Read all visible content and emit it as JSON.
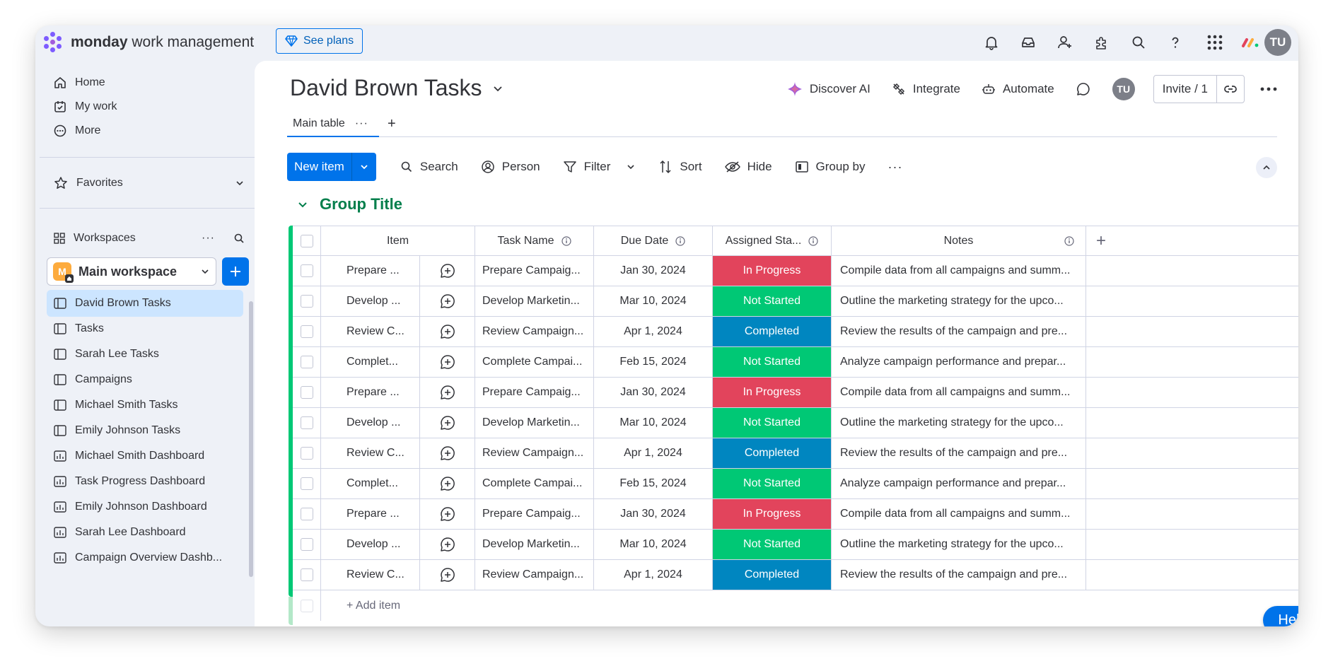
{
  "app": {
    "brand_bold": "monday",
    "brand_rest": " work management",
    "see_plans": "See plans",
    "user_initials": "TU",
    "colors": {
      "primary": "#0073ea",
      "group": "#00c875",
      "group_title": "#037f4c",
      "in_progress": "#e2445c",
      "not_started": "#00c875",
      "completed": "#0086c0"
    }
  },
  "sidebar": {
    "nav": [
      {
        "label": "Home",
        "icon": "home-icon"
      },
      {
        "label": "My work",
        "icon": "calendar-check-icon"
      },
      {
        "label": "More",
        "icon": "more-circle-icon"
      }
    ],
    "favorites": "Favorites",
    "workspaces": "Workspaces",
    "workspace_letter": "M",
    "workspace_name": "Main workspace",
    "boards": [
      {
        "label": "David Brown Tasks",
        "type": "board",
        "active": true
      },
      {
        "label": "Tasks",
        "type": "board"
      },
      {
        "label": "Sarah Lee Tasks",
        "type": "board"
      },
      {
        "label": "Campaigns",
        "type": "board"
      },
      {
        "label": "Michael Smith Tasks",
        "type": "board"
      },
      {
        "label": "Emily Johnson Tasks",
        "type": "board"
      },
      {
        "label": "Michael Smith Dashboard",
        "type": "dashboard"
      },
      {
        "label": "Task Progress Dashboard",
        "type": "dashboard"
      },
      {
        "label": "Emily Johnson Dashboard",
        "type": "dashboard"
      },
      {
        "label": "Sarah Lee Dashboard",
        "type": "dashboard"
      },
      {
        "label": "Campaign Overview Dashb...",
        "type": "dashboard"
      }
    ]
  },
  "board": {
    "title": "David Brown Tasks",
    "actions": {
      "discover_ai": "Discover AI",
      "integrate": "Integrate",
      "automate": "Automate",
      "invite": "Invite / 1"
    },
    "tabs": {
      "main": "Main table",
      "more": "···",
      "add": "+"
    },
    "toolbar": {
      "new_item": "New item",
      "search": "Search",
      "person": "Person",
      "filter": "Filter",
      "sort": "Sort",
      "hide": "Hide",
      "group_by": "Group by",
      "more": "···"
    },
    "group_title": "Group Title",
    "columns": {
      "item": "Item",
      "task_name": "Task Name",
      "due_date": "Due Date",
      "assigned_status": "Assigned Sta...",
      "notes": "Notes",
      "add": "+"
    },
    "rows": [
      {
        "item": "Prepare ...",
        "task": "Prepare Campaig...",
        "due": "Jan 30, 2024",
        "status": "In Progress",
        "notes": "Compile data from all campaigns and summ..."
      },
      {
        "item": "Develop ...",
        "task": "Develop Marketin...",
        "due": "Mar 10, 2024",
        "status": "Not Started",
        "notes": "Outline the marketing strategy for the upco..."
      },
      {
        "item": "Review C...",
        "task": "Review Campaign...",
        "due": "Apr 1, 2024",
        "status": "Completed",
        "notes": "Review the results of the campaign and pre..."
      },
      {
        "item": "Complet...",
        "task": "Complete Campai...",
        "due": "Feb 15, 2024",
        "status": "Not Started",
        "notes": "Analyze campaign performance and prepar..."
      },
      {
        "item": "Prepare ...",
        "task": "Prepare Campaig...",
        "due": "Jan 30, 2024",
        "status": "In Progress",
        "notes": "Compile data from all campaigns and summ..."
      },
      {
        "item": "Develop ...",
        "task": "Develop Marketin...",
        "due": "Mar 10, 2024",
        "status": "Not Started",
        "notes": "Outline the marketing strategy for the upco..."
      },
      {
        "item": "Review C...",
        "task": "Review Campaign...",
        "due": "Apr 1, 2024",
        "status": "Completed",
        "notes": "Review the results of the campaign and pre..."
      },
      {
        "item": "Complet...",
        "task": "Complete Campai...",
        "due": "Feb 15, 2024",
        "status": "Not Started",
        "notes": "Analyze campaign performance and prepar..."
      },
      {
        "item": "Prepare ...",
        "task": "Prepare Campaig...",
        "due": "Jan 30, 2024",
        "status": "In Progress",
        "notes": "Compile data from all campaigns and summ..."
      },
      {
        "item": "Develop ...",
        "task": "Develop Marketin...",
        "due": "Mar 10, 2024",
        "status": "Not Started",
        "notes": "Outline the marketing strategy for the upco..."
      },
      {
        "item": "Review C...",
        "task": "Review Campaign...",
        "due": "Apr 1, 2024",
        "status": "Completed",
        "notes": "Review the results of the campaign and pre..."
      }
    ],
    "add_item": "+ Add item"
  },
  "help": "Help"
}
